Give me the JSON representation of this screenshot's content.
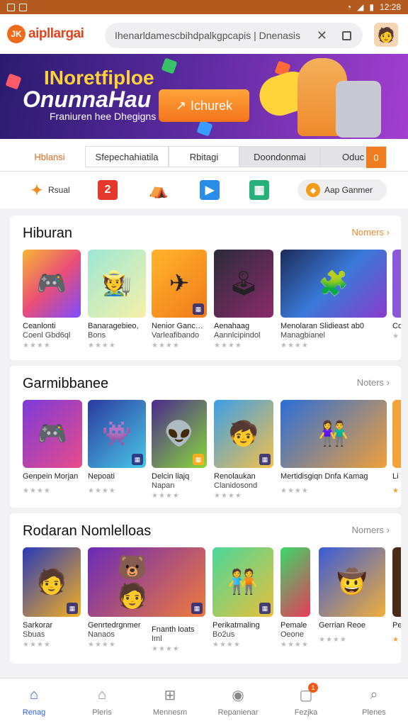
{
  "status_bar": {
    "time": "12:28"
  },
  "header": {
    "logo_mark": "JK",
    "logo_text": "aipllargai",
    "search_placeholder": "Ihenarldamescbihdpalkgpcapis | Dnenasis",
    "search_icon_clear": "close-icon",
    "avatar_icon": "avatar"
  },
  "banner": {
    "title_line1": "INoretfiploe",
    "title_line2": "OnunnaHau",
    "subtitle": "Franiuren hee Dhegigns",
    "cta_label": "Ichurek"
  },
  "tabs": [
    {
      "label": "Hblansi",
      "active": true
    },
    {
      "label": "Sfepechahiatila"
    },
    {
      "label": "Rbitagi"
    },
    {
      "label": "Doondonmai"
    },
    {
      "label": "Oduc",
      "badge": "0"
    }
  ],
  "quick": {
    "item1_label": "Rsual",
    "item2_glyph": "2",
    "app_label": "Aap Ganmer"
  },
  "sections": [
    {
      "title": "Hiburan",
      "more": "Nomers",
      "cards": [
        {
          "name1": "Ceanlonti",
          "name2": "Coenl Gbd6ql",
          "stars": "★★★★"
        },
        {
          "name1": "Banaragebieo,",
          "name2": "Bons",
          "stars": "★★★★"
        },
        {
          "name1": "Nenior Gancdan",
          "name2": "Varleafibando",
          "stars": "★★★★"
        },
        {
          "name1": "Aenahaag",
          "name2": "Aannlcipindol",
          "stars": "★★★★"
        },
        {
          "name1": "Menolaran Slidieast ab0",
          "name2": "Managbianel",
          "stars": "★★★★"
        },
        {
          "name1": "Co",
          "name2": "",
          "stars": "★"
        }
      ]
    },
    {
      "title": "Garmibbanee",
      "more": "Noters",
      "cards": [
        {
          "name1": "Genpein Morjan",
          "name2": "",
          "stars": "★★★★"
        },
        {
          "name1": "Nepoati",
          "name2": "",
          "stars": "★★★★"
        },
        {
          "name1": "Delcin liajq",
          "name2": "Napan",
          "stars": "★★★★"
        },
        {
          "name1": "Renolaukan",
          "name2": "Clanidosond",
          "stars": "★★★★"
        },
        {
          "name1": "Mertidisgiqn Dnfa Kamag",
          "name2": "",
          "stars": "★★★★"
        },
        {
          "name1": "Li",
          "name2": "",
          "stars": "★"
        }
      ]
    },
    {
      "title": "Rodaran Nomlelloas",
      "more": "Nomers",
      "cards": [
        {
          "name1": "Sarkorar",
          "name2": "Sbuas",
          "stars": "★★★★"
        },
        {
          "name1": "Genrtedrgnmer",
          "name2": "Nanaos",
          "stars": "★★★★"
        },
        {
          "name1": "Fnanth loats",
          "name2": "Iml",
          "stars": "★★★★"
        },
        {
          "name1": "Perikatmaling",
          "name2": "Bo2us",
          "stars": "★★★★"
        },
        {
          "name1": "Pemale",
          "name2": "Oeone",
          "stars": "★★★★"
        },
        {
          "name1": "Gerrian Reoe",
          "name2": "",
          "stars": "★★★★"
        },
        {
          "name1": "Pe",
          "name2": "",
          "stars": "★"
        }
      ]
    }
  ],
  "bottom_nav": [
    {
      "label": "Renag",
      "icon": "home-icon",
      "active": true
    },
    {
      "label": "Pleris",
      "icon": "house-outline-icon"
    },
    {
      "label": "Mennesm",
      "icon": "grid-icon"
    },
    {
      "label": "Repanienar",
      "icon": "chat-icon"
    },
    {
      "label": "Fezjka",
      "icon": "document-icon",
      "badge": "1"
    },
    {
      "label": "Plenes",
      "icon": "search-icon"
    }
  ]
}
